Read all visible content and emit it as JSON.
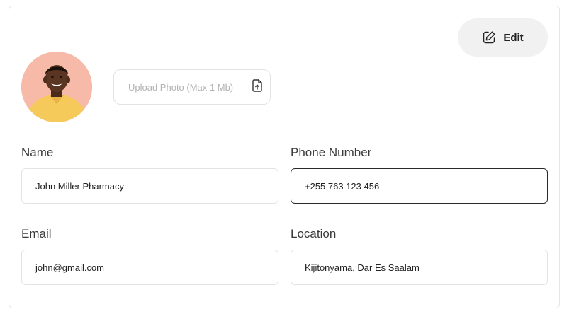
{
  "toolbar": {
    "edit_label": "Edit",
    "edit_icon": "edit-square-icon"
  },
  "upload": {
    "label": "Upload Photo (Max 1 Mb)",
    "icon": "file-upload-icon"
  },
  "fields": {
    "name": {
      "label": "Name",
      "value": "John Miller Pharmacy"
    },
    "phone": {
      "label": "Phone Number",
      "value": "+255 763 123 456"
    },
    "email": {
      "label": "Email",
      "value": "john@gmail.com"
    },
    "location": {
      "label": "Location",
      "value": "Kijitonyama, Dar Es Saalam"
    }
  },
  "colors": {
    "avatar_bg": "#f7b9a8",
    "shirt": "#f5c95a",
    "button_bg": "#f1f1f1",
    "active_border": "#2a2a2a"
  }
}
